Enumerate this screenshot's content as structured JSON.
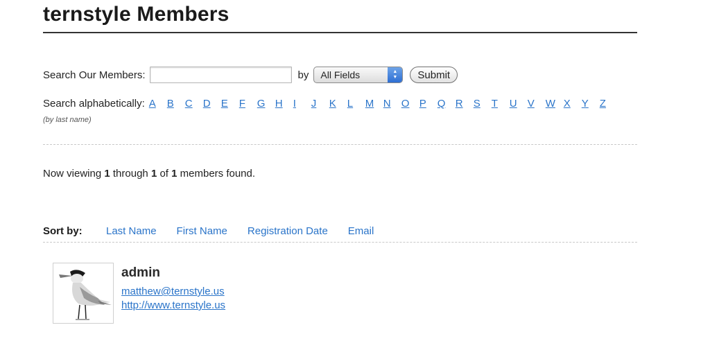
{
  "page": {
    "title": "ternstyle Members"
  },
  "search": {
    "label": "Search Our Members:",
    "input_value": "",
    "by_label": "by",
    "field_selected": "All Fields",
    "submit_label": "Submit"
  },
  "alphabet": {
    "label": "Search alphabetically:",
    "note": "(by last name)",
    "letters": [
      "A",
      "B",
      "C",
      "D",
      "E",
      "F",
      "G",
      "H",
      "I",
      "J",
      "K",
      "L",
      "M",
      "N",
      "O",
      "P",
      "Q",
      "R",
      "S",
      "T",
      "U",
      "V",
      "W",
      "X",
      "Y",
      "Z"
    ]
  },
  "results": {
    "prefix": "Now viewing ",
    "start": "1",
    "through": " through ",
    "end": "1",
    "of": " of ",
    "total": "1",
    "suffix": " members found."
  },
  "sort": {
    "label": "Sort by:",
    "options": [
      "Last Name",
      "First Name",
      "Registration Date",
      "Email"
    ]
  },
  "members": [
    {
      "name": "admin",
      "email": "matthew@ternstyle.us",
      "website": "http://www.ternstyle.us",
      "avatar_icon": "tern-bird-icon"
    }
  ],
  "colors": {
    "link": "#2a74c9",
    "select_arrow": "#2d6ed3"
  }
}
